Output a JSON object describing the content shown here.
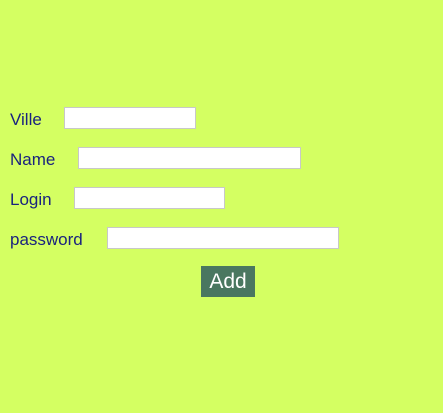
{
  "form": {
    "fields": [
      {
        "label": "Ville",
        "value": ""
      },
      {
        "label": "Name",
        "value": ""
      },
      {
        "label": "Login",
        "value": ""
      },
      {
        "label": "password",
        "value": ""
      }
    ],
    "submit_label": "Add"
  },
  "colors": {
    "background": "#d4ff62",
    "label": "#1a237e",
    "button_bg": "#4a7760",
    "button_text": "#ffffff"
  }
}
